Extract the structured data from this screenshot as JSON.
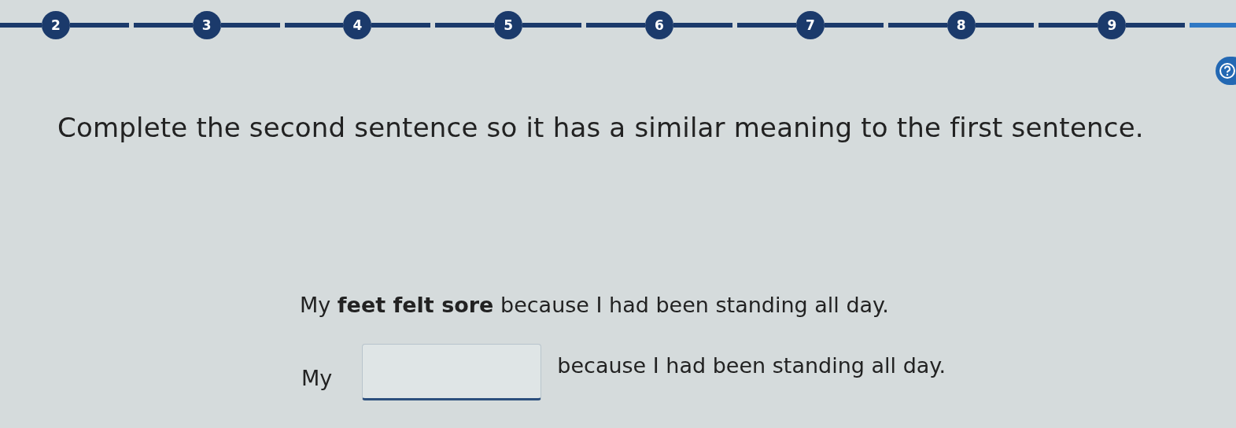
{
  "progress": {
    "steps": [
      {
        "label": "2",
        "completed": true
      },
      {
        "label": "3",
        "completed": true
      },
      {
        "label": "4",
        "completed": true
      },
      {
        "label": "5",
        "completed": true
      },
      {
        "label": "6",
        "completed": true
      },
      {
        "label": "7",
        "completed": true
      },
      {
        "label": "8",
        "completed": true
      },
      {
        "label": "9",
        "completed": true
      }
    ],
    "tail": {
      "completed": false
    }
  },
  "instruction": "Complete the second sentence so it has a similar meaning to the first sentence.",
  "first_sentence": "My **feet felt sore** because I had been standing all day.",
  "second_sentence": {
    "before": "My",
    "after": "because I had been standing all day."
  }
}
